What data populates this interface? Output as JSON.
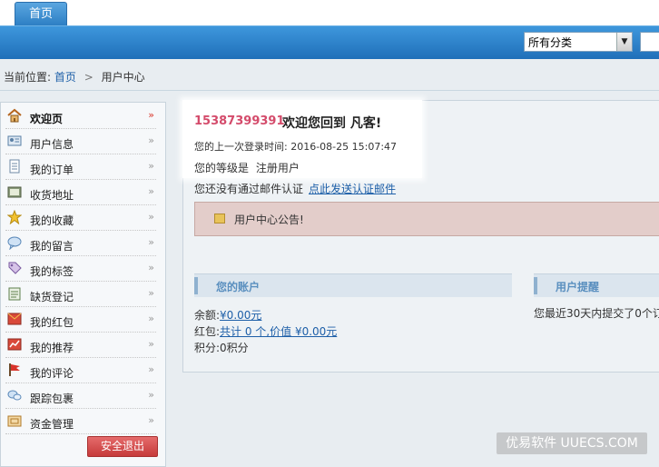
{
  "top_tab": {
    "label": "首页"
  },
  "search": {
    "category_selected": "所有分类",
    "input_value": ""
  },
  "breadcrumb": {
    "prefix": "当前位置:",
    "home": "首页",
    "separator": ">",
    "current": "用户中心"
  },
  "sidebar": {
    "items": [
      {
        "label": "欢迎页",
        "icon": "home-icon",
        "active": true
      },
      {
        "label": "用户信息",
        "icon": "id-card-icon"
      },
      {
        "label": "我的订单",
        "icon": "document-icon"
      },
      {
        "label": "收货地址",
        "icon": "address-book-icon"
      },
      {
        "label": "我的收藏",
        "icon": "star-icon"
      },
      {
        "label": "我的留言",
        "icon": "speech-bubble-icon"
      },
      {
        "label": "我的标签",
        "icon": "tag-icon"
      },
      {
        "label": "缺货登记",
        "icon": "clipboard-icon"
      },
      {
        "label": "我的红包",
        "icon": "red-envelope-icon"
      },
      {
        "label": "我的推荐",
        "icon": "recommend-icon"
      },
      {
        "label": "我的评论",
        "icon": "flag-icon"
      },
      {
        "label": "跟踪包裹",
        "icon": "tracking-icon"
      },
      {
        "label": "资金管理",
        "icon": "wallet-icon"
      }
    ],
    "logout_label": "安全退出"
  },
  "welcome": {
    "phone": "15387399391",
    "greeting": "欢迎您回到 凡客!",
    "last_login": "您的上一次登录时间: 2016-08-25 15:07:47",
    "level_prefix": "您的等级是",
    "level_value": "注册用户",
    "email_notice": "您还没有通过邮件认证",
    "email_link": "点此发送认证邮件"
  },
  "notice": {
    "text": "用户中心公告!"
  },
  "account": {
    "heading": "您的账户",
    "balance_label": "余额:",
    "balance_value": "¥0.00元",
    "bonus_label": "红包:",
    "bonus_value": "共计 0 个,价值 ¥0.00元",
    "points": "积分:0积分"
  },
  "reminder": {
    "heading": "用户提醒",
    "text": "您最近30天内提交了0个订"
  },
  "watermark": "优易软件 UUECS.COM",
  "colors": {
    "nav_blue": "#2d7fc4",
    "phone_red": "#d44b6b",
    "link_blue": "#1d5fa8",
    "logout_red": "#c63a3a"
  }
}
